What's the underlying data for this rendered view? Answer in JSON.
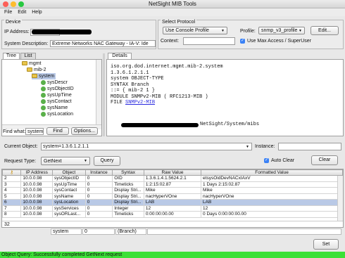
{
  "window": {
    "title": "NetSight MIB Tools"
  },
  "menu": [
    "File",
    "Edit",
    "Help"
  ],
  "device": {
    "group_label": "Device",
    "ip_label": "IP Address:",
    "sysdesc_label": "System Description:",
    "sysdesc_value": "Extreme Networks NAC Gateway - IA-V: Ide"
  },
  "protocol": {
    "group_label": "Select Protocol",
    "console_option": "Use Console Profile",
    "context_label": "Context:",
    "profile_label": "Profile:",
    "profile_value": "snmp_v3_profile",
    "edit_button": "Edit...",
    "maxaccess_label": "Use Max Access / SuperUser",
    "maxaccess_checked": true
  },
  "left_tabs": [
    "Tree",
    "List"
  ],
  "tree": [
    {
      "label": "mgmt",
      "kind": "folder"
    },
    {
      "label": "mib-2",
      "kind": "folder"
    },
    {
      "label": "system",
      "kind": "folder"
    },
    {
      "label": "sysDescr",
      "kind": "leaf"
    },
    {
      "label": "sysObjectID",
      "kind": "leaf"
    },
    {
      "label": "sysUpTime",
      "kind": "leaf"
    },
    {
      "label": "sysContact",
      "kind": "leaf"
    },
    {
      "label": "sysName",
      "kind": "leaf"
    },
    {
      "label": "sysLocation",
      "kind": "leaf"
    }
  ],
  "find": {
    "label": "Find what:",
    "value": "system",
    "find_button": "Find",
    "options_button": "Options..."
  },
  "details": {
    "tab": "Details",
    "lines": [
      "iso.org.dod.internet.mgmt.mib-2.system",
      "1.3.6.1.2.1.1",
      "",
      "system OBJECT-TYPE",
      "SYNTAX Branch",
      "::= { mib-2 1 }",
      "",
      "MODULE SNMPv2-MIB ( RFC1213-MIB )"
    ],
    "file_label": "FILE",
    "file_link": "SNMPv2-MIB",
    "file_path_tail": "NetSight/System/mibs"
  },
  "query": {
    "current_object_label": "Current Object:",
    "current_object_value": "system=1.3.6.1.2.1.1",
    "instance_label": "Instance:",
    "request_type_label": "Request Type:",
    "request_type_value": "GetNext",
    "query_button": "Query",
    "auto_clear_label": "Auto Clear",
    "auto_clear_checked": true,
    "clear_button": "Clear"
  },
  "results": {
    "columns": [
      "",
      "IP Address",
      "Object",
      "Instance",
      "Syntax",
      "Raw Value",
      "Formatted Value"
    ],
    "rows": [
      [
        "2",
        "10.0.0.98",
        "sysObjectID",
        "0",
        "OID",
        "1.3.6.1.4.1.5624.2.1",
        "etsysOidDevNACxIAxV"
      ],
      [
        "3",
        "10.0.0.98",
        "sysUpTime",
        "0",
        "Timeticks",
        "1:2:15:02.87",
        "1 Days 2:15:02.87"
      ],
      [
        "4",
        "10.0.0.98",
        "sysContact",
        "0",
        "Display Stri...",
        "Mike",
        "Mike"
      ],
      [
        "5",
        "10.0.0.98",
        "sysName",
        "0",
        "Display Stri...",
        "nacHyperVOne",
        "nacHyperVOne"
      ],
      [
        "6",
        "10.0.0.98",
        "sysLocation",
        "0",
        "Display Stri...",
        "LAB",
        "LAB"
      ],
      [
        "7",
        "10.0.0.98",
        "sysServices",
        "0",
        "Integer",
        "12",
        "12"
      ],
      [
        "8",
        "10.0.0.98",
        "sysORLast...",
        "0",
        "Timeticks",
        "0:00:00:00.00",
        "0 Days 0:00:00:00.00"
      ]
    ],
    "selected_row": 4,
    "count": "32",
    "footer": [
      "system",
      "0",
      "(Branch)"
    ]
  },
  "set_button": "Set",
  "status": "Object Query: Successfully completed GetNext request",
  "colors": {
    "status_bg": "#3ce037",
    "selection": "#b9c9e6",
    "link": "#2a2adf"
  }
}
